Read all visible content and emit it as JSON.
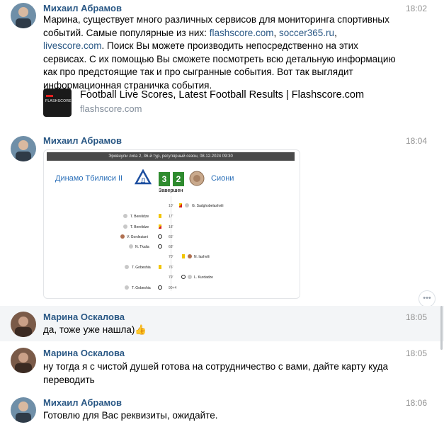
{
  "messages": [
    {
      "author": "Михаил Абрамов",
      "time": "18:02",
      "text_parts": {
        "p1": "Марина, существует много различных сервисов для мониторинга спортивных событий. Самые популярные из них: ",
        "link1": "flashscore.com",
        "sep1": ", ",
        "link2": "soccer365.ru",
        "sep2": ", ",
        "link3": "livescore.com",
        "p2": ". Поиск Вы можете производить непосредственно на этих сервисах. С их помощью Вы сможете посмотреть всю детальную информацию как про предстоящие так и про сыгранные события. Вот так выглядит информационная страничка события."
      },
      "link_preview": {
        "logo_text": "FLASHSCORE",
        "title": "Football Live Scores, Latest Football Results | Flashscore.com",
        "domain": "flashscore.com"
      }
    },
    {
      "author": "Михаил Абрамов",
      "time": "18:04",
      "match": {
        "header": "Эровнули лига 2, 36-й тур, регулярный сезон, 08.12.2024 09:30",
        "home": "Динамо Тбилиси II",
        "away": "Сиони",
        "home_score": "3",
        "away_score": "2",
        "status": "Завершен",
        "events": [
          {
            "min": "10'",
            "player": "G. Sadghobelashvili"
          },
          {
            "min": "17'",
            "player": "T. Berelidze"
          },
          {
            "min": "18'",
            "player": "T. Berelidze"
          },
          {
            "min": "65'",
            "player": "V. Gordeziani"
          },
          {
            "min": "68'",
            "player": "N. Tkalia"
          },
          {
            "min": "70'",
            "player": "N. Iashvili"
          },
          {
            "min": "76'",
            "player": "T. Gobeshia"
          },
          {
            "min": "79'",
            "player": "L. Kurdadze"
          },
          {
            "min": "90+4",
            "player": "T. Gobeshia"
          }
        ]
      }
    },
    {
      "author": "Марина Оскалова",
      "time": "18:05",
      "text": "да, тоже уже нашла)👍"
    },
    {
      "author": "Марина Оскалова",
      "time": "18:05",
      "text": "ну тогда я с чистой душей готова на сотрудничество с вами, дайте карту куда переводить"
    },
    {
      "author": "Михаил Абрамов",
      "time": "18:06",
      "text": "Готовлю для Вас реквизиты, ожидайте."
    }
  ],
  "more_button": "•••",
  "colors": {
    "author": "#2a5885",
    "link": "#2a5885",
    "time": "#939393",
    "highlight": "#f3f5f7"
  }
}
